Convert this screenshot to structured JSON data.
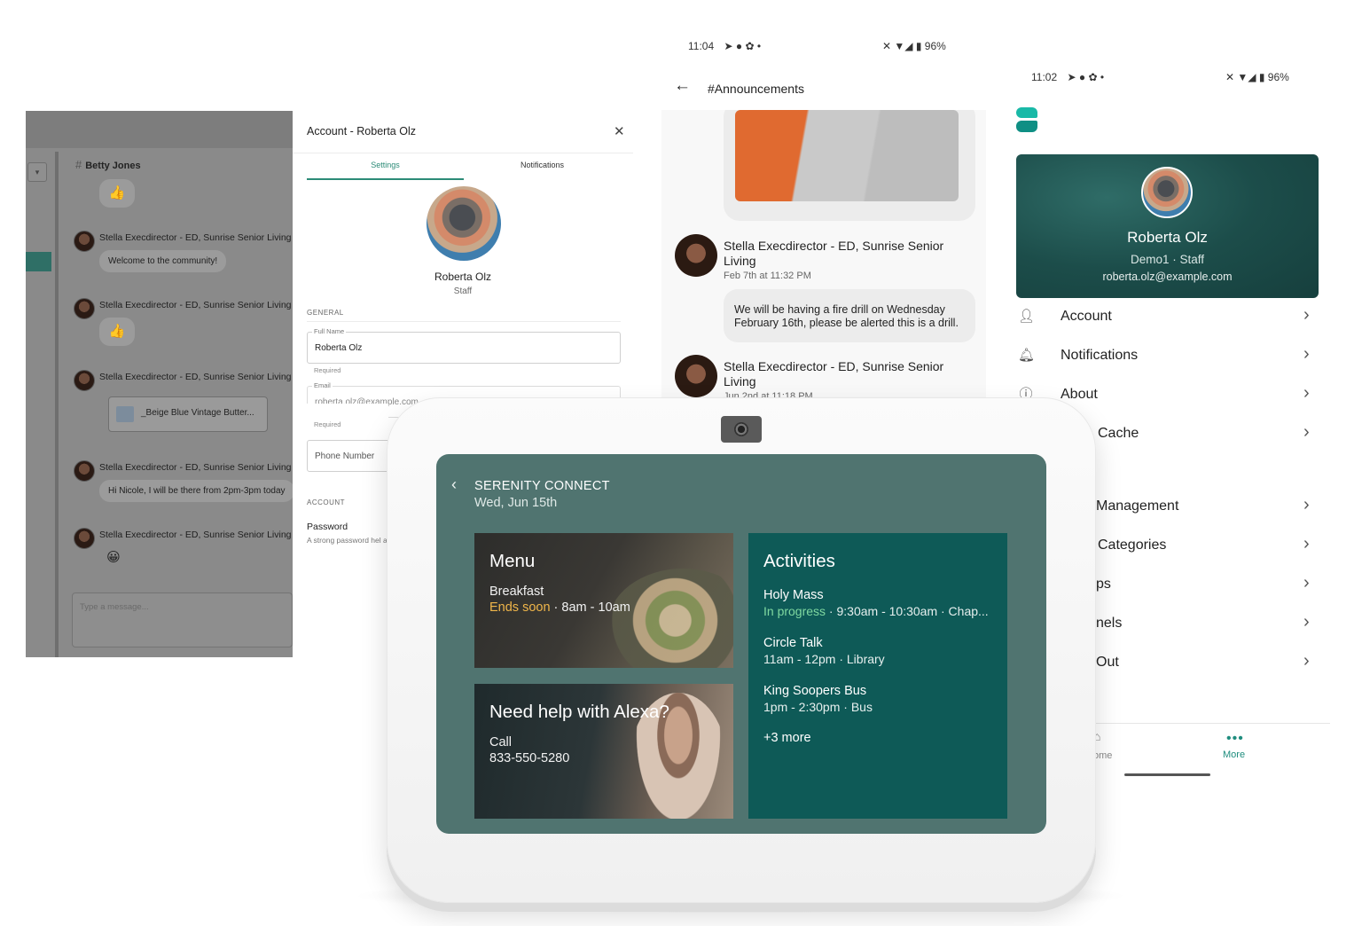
{
  "desktop_chat": {
    "channel": "Betty Jones",
    "author": "Stella Execdirector - ED, Sunrise Senior Living",
    "messages": [
      {
        "text": "Welcome to the community!"
      },
      {
        "text": "Hi Nicole, I will be there from 2pm-3pm today"
      }
    ],
    "file_name": "_Beige Blue Vintage Butter...",
    "emoji_thumbs": "👍",
    "emoji_smile": "😀",
    "input_placeholder": "Type a message..."
  },
  "account_panel": {
    "title": "Account - Roberta Olz",
    "tabs": [
      "Settings",
      "Notifications"
    ],
    "name": "Roberta Olz",
    "role": "Staff",
    "section_general": "GENERAL",
    "full_name_label": "Full Name",
    "full_name_value": "Roberta Olz",
    "required": "Required",
    "email_label": "Email",
    "email_value": "roberta.olz@example.com",
    "phone_placeholder": "Phone Number",
    "section_account": "ACCOUNT",
    "password_label": "Password",
    "password_desc": "A strong password hel account."
  },
  "announcements": {
    "status_time": "11:04",
    "status_battery": "96%",
    "title": "#Announcements",
    "posts": [
      {
        "author": "Stella Execdirector  - ED, Sunrise Senior Living",
        "time": "Feb 7th at 11:32 PM",
        "text": "We will be having a fire drill on Wednesday February 16th, please be alerted this is a drill."
      },
      {
        "author": "Stella Execdirector  - ED, Sunrise Senior Living",
        "time": "Jun 2nd at 11:18 PM"
      }
    ]
  },
  "settings_phone": {
    "status_time": "11:02",
    "status_battery": "96%",
    "profile": {
      "name": "Roberta Olz",
      "sub": "Demo1 · Staff",
      "email": "roberta.olz@example.com"
    },
    "menu": [
      "Account",
      "Notifications",
      "About",
      "Cache",
      "Management",
      "Categories",
      "ps",
      "nels",
      "Out"
    ],
    "tabs": {
      "home": "ome",
      "more": "More"
    }
  },
  "echo_show": {
    "header": "SERENITY CONNECT",
    "date": "Wed, Jun 15th",
    "menu_tile": {
      "title": "Menu",
      "meal": "Breakfast",
      "status": "Ends soon",
      "time": " · 8am - 10am"
    },
    "help_tile": {
      "title": "Need help with Alexa?",
      "line1": "Call",
      "phone": "833-550-5280"
    },
    "activities_tile": {
      "title": "Activities",
      "items": [
        {
          "name": "Holy Mass",
          "status": "In progress",
          "detail": " · 9:30am - 10:30am · Chap..."
        },
        {
          "name": "Circle Talk",
          "detail": "11am - 12pm · Library"
        },
        {
          "name": "King Soopers Bus",
          "detail": "1pm - 2:30pm · Bus"
        }
      ],
      "more": "+3 more"
    }
  }
}
